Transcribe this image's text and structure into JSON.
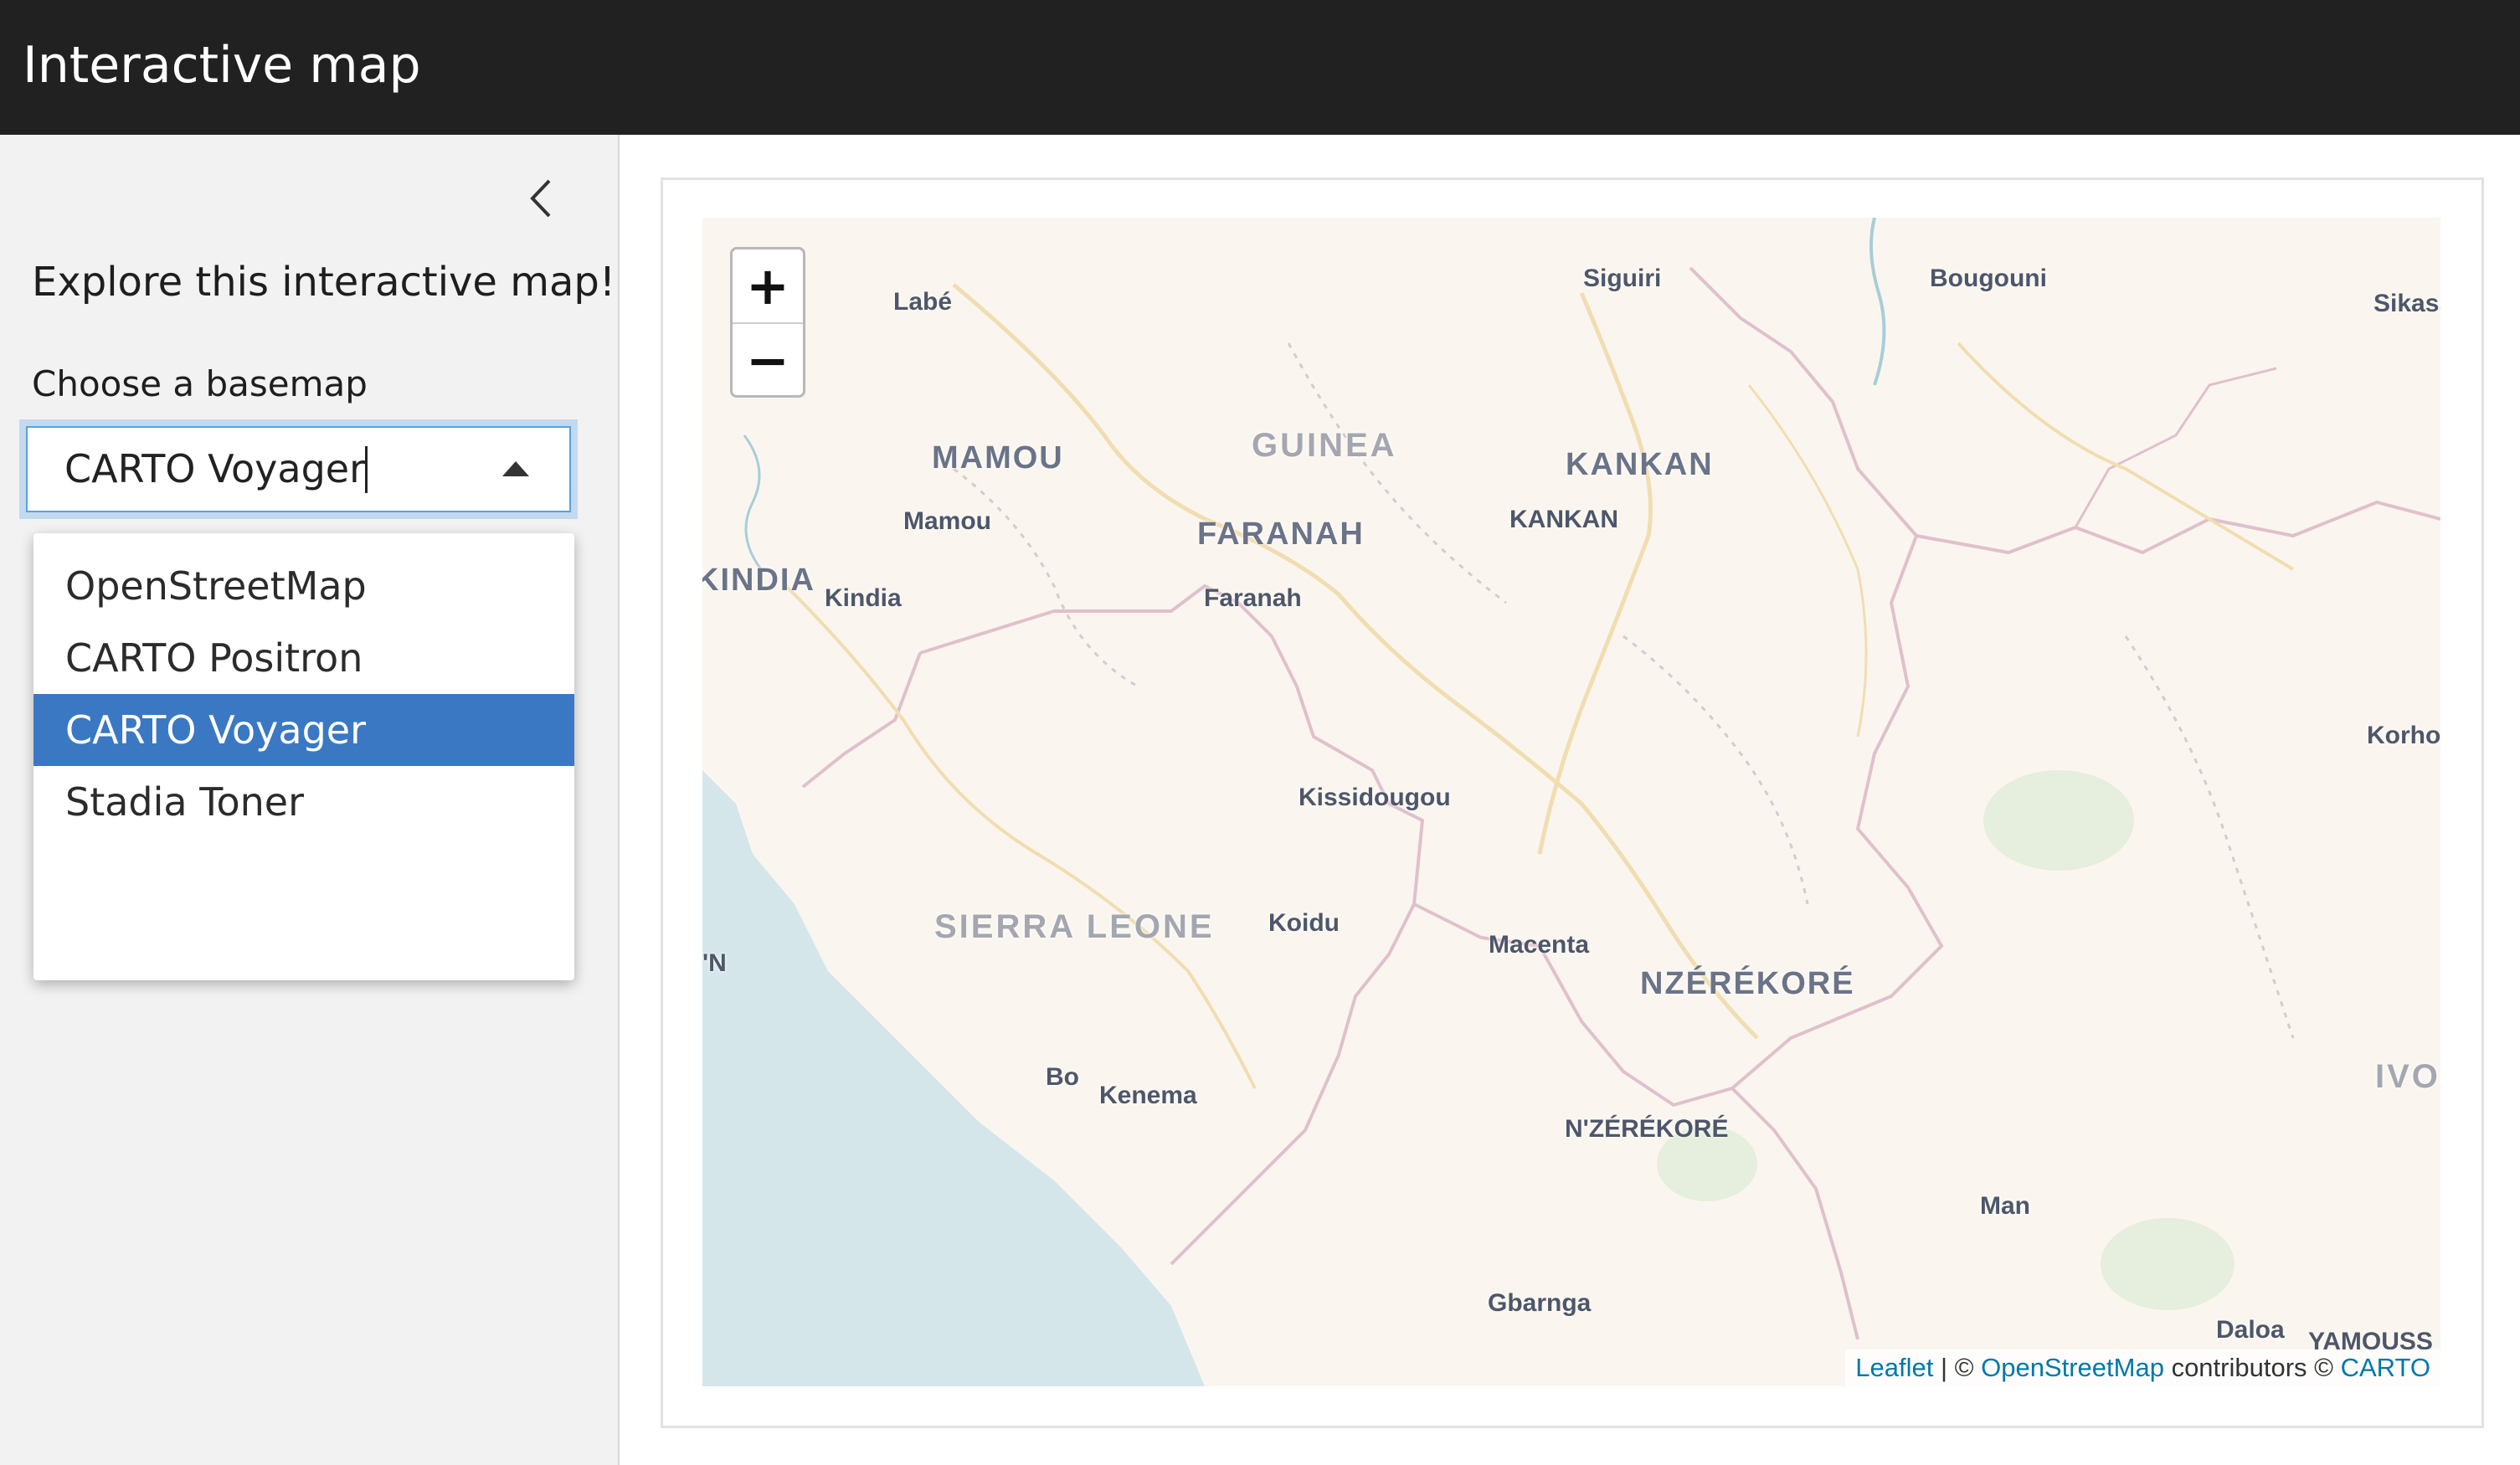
{
  "header": {
    "title": "Interactive map"
  },
  "sidebar": {
    "intro": "Explore this interactive map!",
    "select_label": "Choose a basemap",
    "selected": "CARTO Voyager",
    "options": [
      "OpenStreetMap",
      "CARTO Positron",
      "CARTO Voyager",
      "Stadia Toner"
    ]
  },
  "map": {
    "zoom_in": "+",
    "zoom_out": "−",
    "labels": {
      "labe": "Labé",
      "siguiri": "Siguiri",
      "bougouni": "Bougouni",
      "sikasso": "Sikass",
      "mamou_region": "MAMOU",
      "guinea": "GUINEA",
      "kankan_region": "KANKAN",
      "mamou": "Mamou",
      "faranah_region": "FARANAH",
      "kankan": "KANKAN",
      "kindia_region": "KINDIA",
      "kindia": "Kindia",
      "faranah": "Faranah",
      "korhogo": "Korho",
      "kissidougou": "Kissidougou",
      "sierra_leone": "SIERRA LEONE",
      "koidu": "Koidu",
      "macenta": "Macenta",
      "nzerekore_region": "NZÉRÉKORÉ",
      "freetown": "'N",
      "bo": "Bo",
      "kenema": "Kenema",
      "nzerekore": "N'ZÉRÉKORÉ",
      "ivory": "IVO",
      "man": "Man",
      "gbarnga": "Gbarnga",
      "daloa": "Daloa",
      "yamoussoukro": "YAMOUSS"
    },
    "attribution": {
      "leaflet": "Leaflet",
      "sep": " | © ",
      "osm": "OpenStreetMap",
      "contributors": " contributors © ",
      "carto": "CARTO"
    }
  }
}
